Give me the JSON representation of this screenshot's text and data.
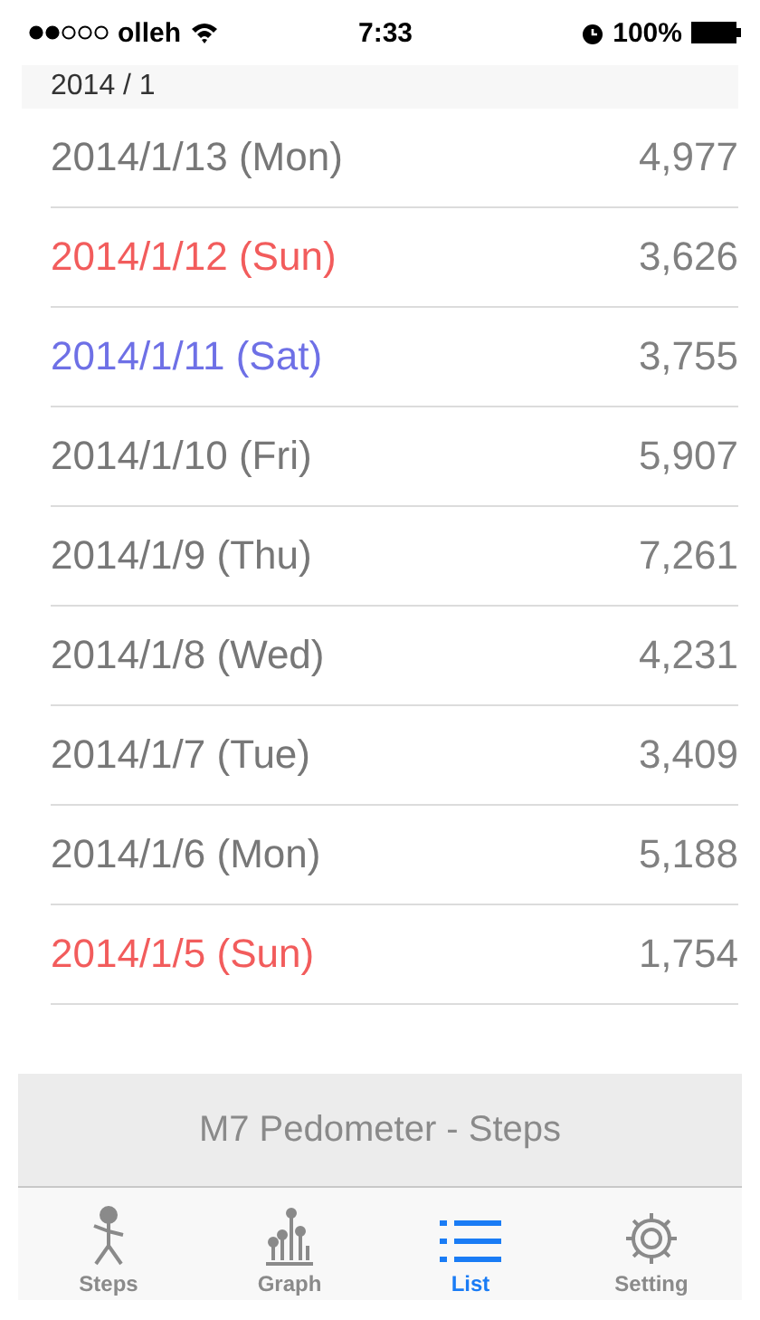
{
  "status_bar": {
    "carrier": "olleh",
    "time": "7:33",
    "battery": "100%"
  },
  "section_header": "2014 / 1",
  "rows": [
    {
      "date": "2014/1/13 (Mon)",
      "steps": "4,977",
      "kind": "weekday"
    },
    {
      "date": "2014/1/12 (Sun)",
      "steps": "3,626",
      "kind": "sunday"
    },
    {
      "date": "2014/1/11 (Sat)",
      "steps": "3,755",
      "kind": "saturday"
    },
    {
      "date": "2014/1/10 (Fri)",
      "steps": "5,907",
      "kind": "weekday"
    },
    {
      "date": "2014/1/9 (Thu)",
      "steps": "7,261",
      "kind": "weekday"
    },
    {
      "date": "2014/1/8 (Wed)",
      "steps": "4,231",
      "kind": "weekday"
    },
    {
      "date": "2014/1/7 (Tue)",
      "steps": "3,409",
      "kind": "weekday"
    },
    {
      "date": "2014/1/6 (Mon)",
      "steps": "5,188",
      "kind": "weekday"
    },
    {
      "date": "2014/1/5 (Sun)",
      "steps": "1,754",
      "kind": "sunday"
    }
  ],
  "banner": "M7 Pedometer - Steps",
  "tabs": [
    {
      "label": "Steps",
      "kind": "steps",
      "selected": false
    },
    {
      "label": "Graph",
      "kind": "graph",
      "selected": false
    },
    {
      "label": "List",
      "kind": "list",
      "selected": true
    },
    {
      "label": "Setting",
      "kind": "setting",
      "selected": false
    }
  ]
}
